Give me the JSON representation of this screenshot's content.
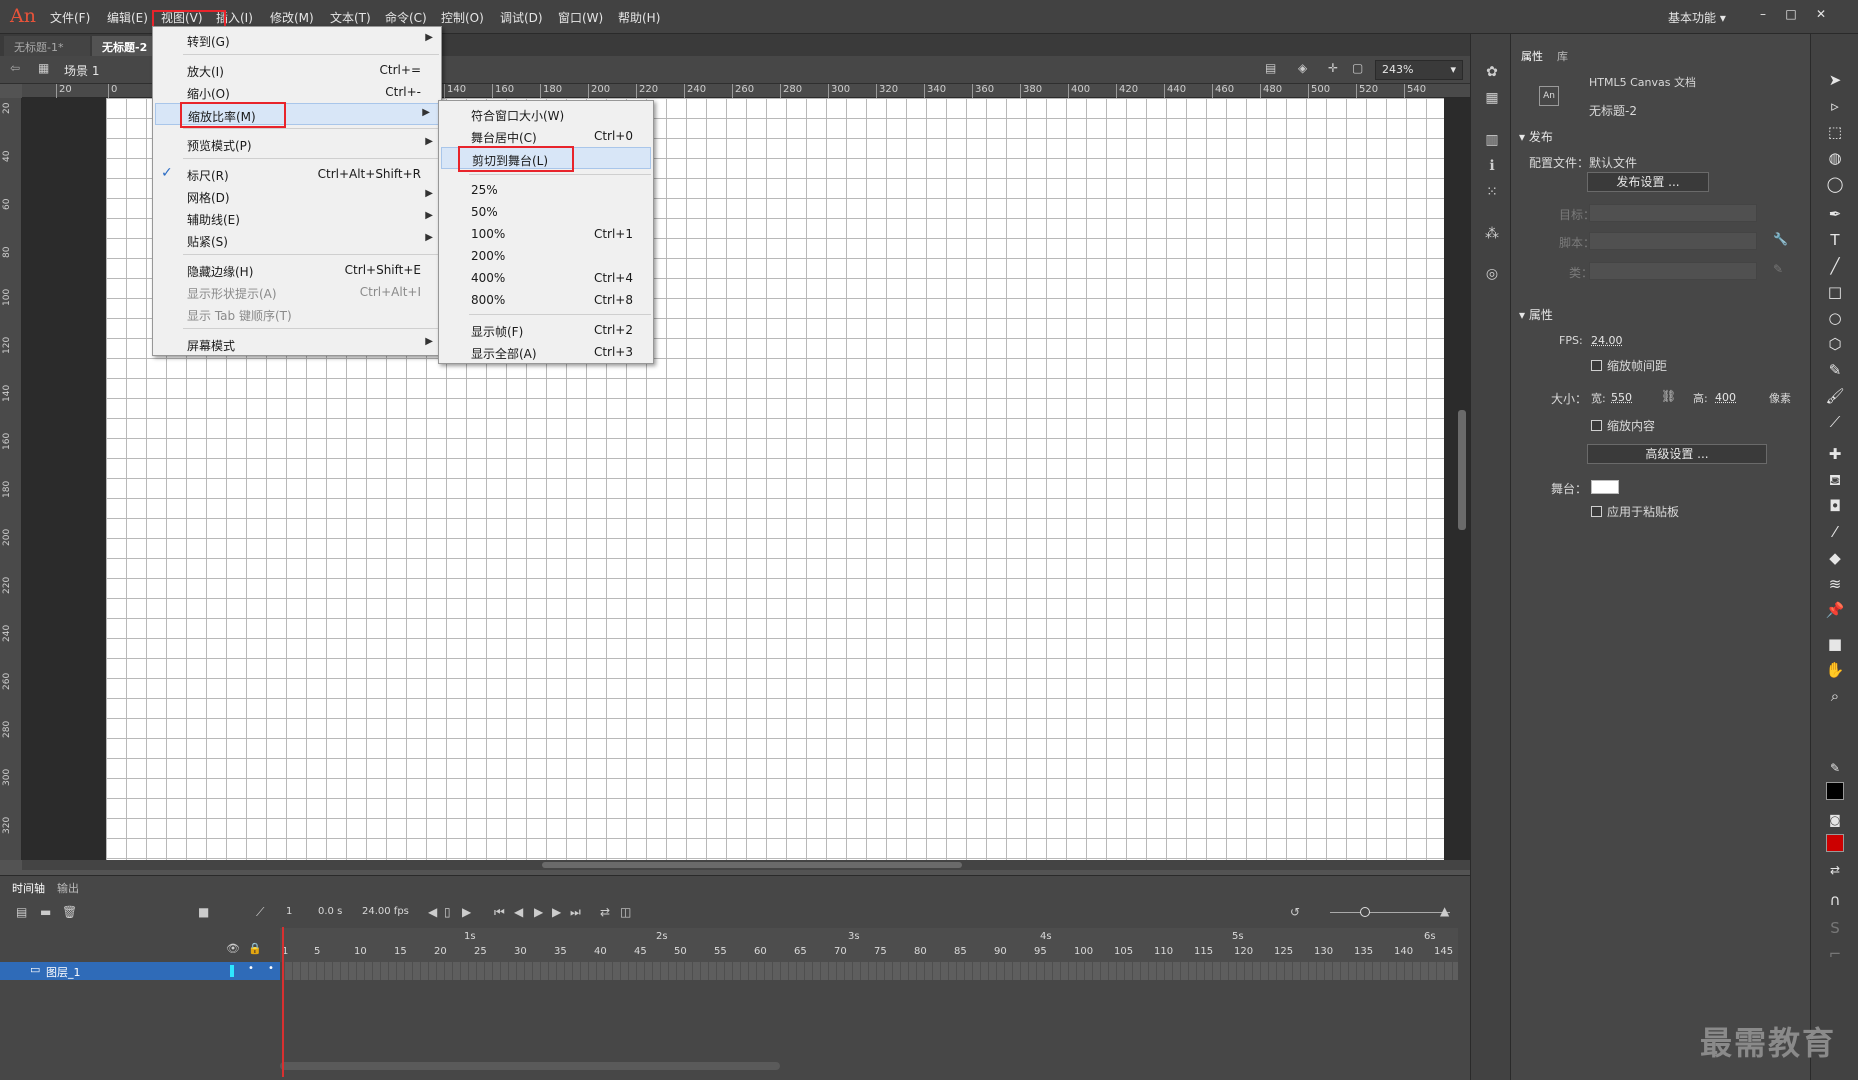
{
  "app": {
    "logo": "An"
  },
  "menubar": {
    "items": [
      "文件(F)",
      "编辑(E)",
      "视图(V)",
      "插入(I)",
      "修改(M)",
      "文本(T)",
      "命令(C)",
      "控制(O)",
      "调试(D)",
      "窗口(W)",
      "帮助(H)"
    ],
    "workspace": "基本功能",
    "window_buttons": [
      "–",
      "□",
      "✕"
    ]
  },
  "doc_tabs": [
    "无标题-1*",
    "无标题-2"
  ],
  "edit_bar": {
    "scene": "场景 1",
    "zoom": "243%"
  },
  "ruler_h": [
    "20",
    "0",
    "140",
    "160",
    "180",
    "200",
    "220",
    "240",
    "260",
    "280",
    "300",
    "320",
    "340",
    "360",
    "380",
    "400",
    "420",
    "440",
    "460",
    "480",
    "500",
    "520",
    "540"
  ],
  "ruler_v": [
    "20",
    "40",
    "60",
    "80",
    "100",
    "120",
    "140",
    "160",
    "180",
    "200",
    "220",
    "240",
    "260",
    "280",
    "300",
    "320"
  ],
  "view_menu": {
    "items": [
      {
        "label": "转到(G)",
        "shortcut": "",
        "submenu": true
      },
      {
        "label": "放大(I)",
        "shortcut": "Ctrl+="
      },
      {
        "label": "缩小(O)",
        "shortcut": "Ctrl+-"
      },
      {
        "label": "缩放比率(M)",
        "shortcut": "",
        "submenu": true
      },
      {
        "label": "预览模式(P)",
        "shortcut": "",
        "submenu": true
      },
      {
        "label": "标尺(R)",
        "shortcut": "Ctrl+Alt+Shift+R",
        "checked": true
      },
      {
        "label": "网格(D)",
        "shortcut": "",
        "submenu": true
      },
      {
        "label": "辅助线(E)",
        "shortcut": "",
        "submenu": true
      },
      {
        "label": "贴紧(S)",
        "shortcut": "",
        "submenu": true
      },
      {
        "label": "隐藏边缘(H)",
        "shortcut": "Ctrl+Shift+E"
      },
      {
        "label": "显示形状提示(A)",
        "shortcut": "Ctrl+Alt+I",
        "disabled": true
      },
      {
        "label": "显示 Tab 键顺序(T)",
        "shortcut": "",
        "disabled": true
      },
      {
        "label": "屏幕模式",
        "shortcut": "",
        "submenu": true
      }
    ]
  },
  "zoom_menu": {
    "items": [
      {
        "label": "符合窗口大小(W)",
        "shortcut": ""
      },
      {
        "label": "舞台居中(C)",
        "shortcut": "Ctrl+0"
      },
      {
        "label": "剪切到舞台(L)",
        "shortcut": ""
      },
      {
        "label": "25%",
        "shortcut": ""
      },
      {
        "label": "50%",
        "shortcut": ""
      },
      {
        "label": "100%",
        "shortcut": "Ctrl+1"
      },
      {
        "label": "200%",
        "shortcut": ""
      },
      {
        "label": "400%",
        "shortcut": "Ctrl+4"
      },
      {
        "label": "800%",
        "shortcut": "Ctrl+8"
      },
      {
        "label": "显示帧(F)",
        "shortcut": "Ctrl+2"
      },
      {
        "label": "显示全部(A)",
        "shortcut": "Ctrl+3"
      }
    ]
  },
  "timeline": {
    "tabs": [
      "时间轴",
      "输出"
    ],
    "frame_num": "1",
    "time": "0.0 s",
    "fps": "24.00 fps",
    "seconds": [
      "1s",
      "2s",
      "3s",
      "4s",
      "5s",
      "6s"
    ],
    "frames": [
      "1",
      "5",
      "10",
      "15",
      "20",
      "25",
      "30",
      "35",
      "40",
      "45",
      "50",
      "55",
      "60",
      "65",
      "70",
      "75",
      "80",
      "85",
      "90",
      "95",
      "100",
      "105",
      "110",
      "115",
      "120",
      "125",
      "130",
      "135",
      "140",
      "145"
    ],
    "layer_name": "图层_1"
  },
  "properties": {
    "tabs": [
      "属性",
      "库"
    ],
    "doc_type": "HTML5 Canvas 文档",
    "doc_name": "无标题-2",
    "doc_icon": "An",
    "publish_section": "发布",
    "profile_label": "配置文件：默认文件",
    "publish_settings_btn": "发布设置 ...",
    "target_label": "目标：",
    "script_label": "脚本：",
    "class_label": "类：",
    "props_section": "属性",
    "fps_label": "FPS:",
    "fps_value": "24.00",
    "scale_spans": "缩放帧间距",
    "size_label": "大小：",
    "width_label": "宽:",
    "width_value": "550",
    "height_label": "高:",
    "height_value": "400",
    "unit": "像素",
    "scale_content": "缩放内容",
    "advanced_btn": "高级设置 ...",
    "stage_label": "舞台：",
    "apply_pasteboard": "应用于粘贴板"
  },
  "colors": {
    "accent_red": "#e8242b",
    "stage": "#ffffff",
    "fill": "#cc0000",
    "stroke": "#000000"
  },
  "watermark": "最需教育"
}
